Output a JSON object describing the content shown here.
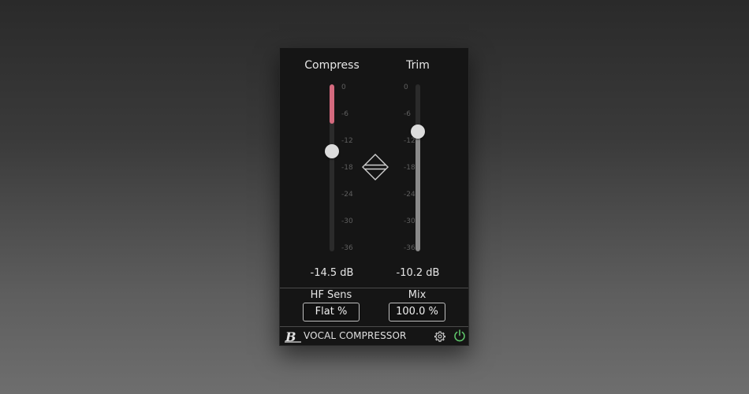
{
  "plugin": {
    "footer_title": "VOCAL COMPRESSOR",
    "logo_glyph": "B"
  },
  "channels": [
    {
      "title": "Compress",
      "readout": "-14.5 dB",
      "slider_value_db": -14.5,
      "meter_top_db": 0,
      "meter_bottom_db": -8.5,
      "meter_color": "#d46a7e"
    },
    {
      "title": "Trim",
      "readout": "-10.2 dB",
      "slider_value_db": -10.2,
      "fill_color": "#8a8a8a"
    }
  ],
  "scale_ticks": [
    "0",
    "-6",
    "-12",
    "-18",
    "-24",
    "-30",
    "-36"
  ],
  "scale_range_db": [
    0,
    -36
  ],
  "params": [
    {
      "label": "HF Sens",
      "value": "Flat %"
    },
    {
      "label": "Mix",
      "value": "100.0 %"
    }
  ],
  "colors": {
    "accent_power": "#5ec46a",
    "panel_bg": "#151515"
  },
  "icons": [
    "link-diamond-icon",
    "gear-icon",
    "power-icon",
    "brand-logo-icon"
  ]
}
